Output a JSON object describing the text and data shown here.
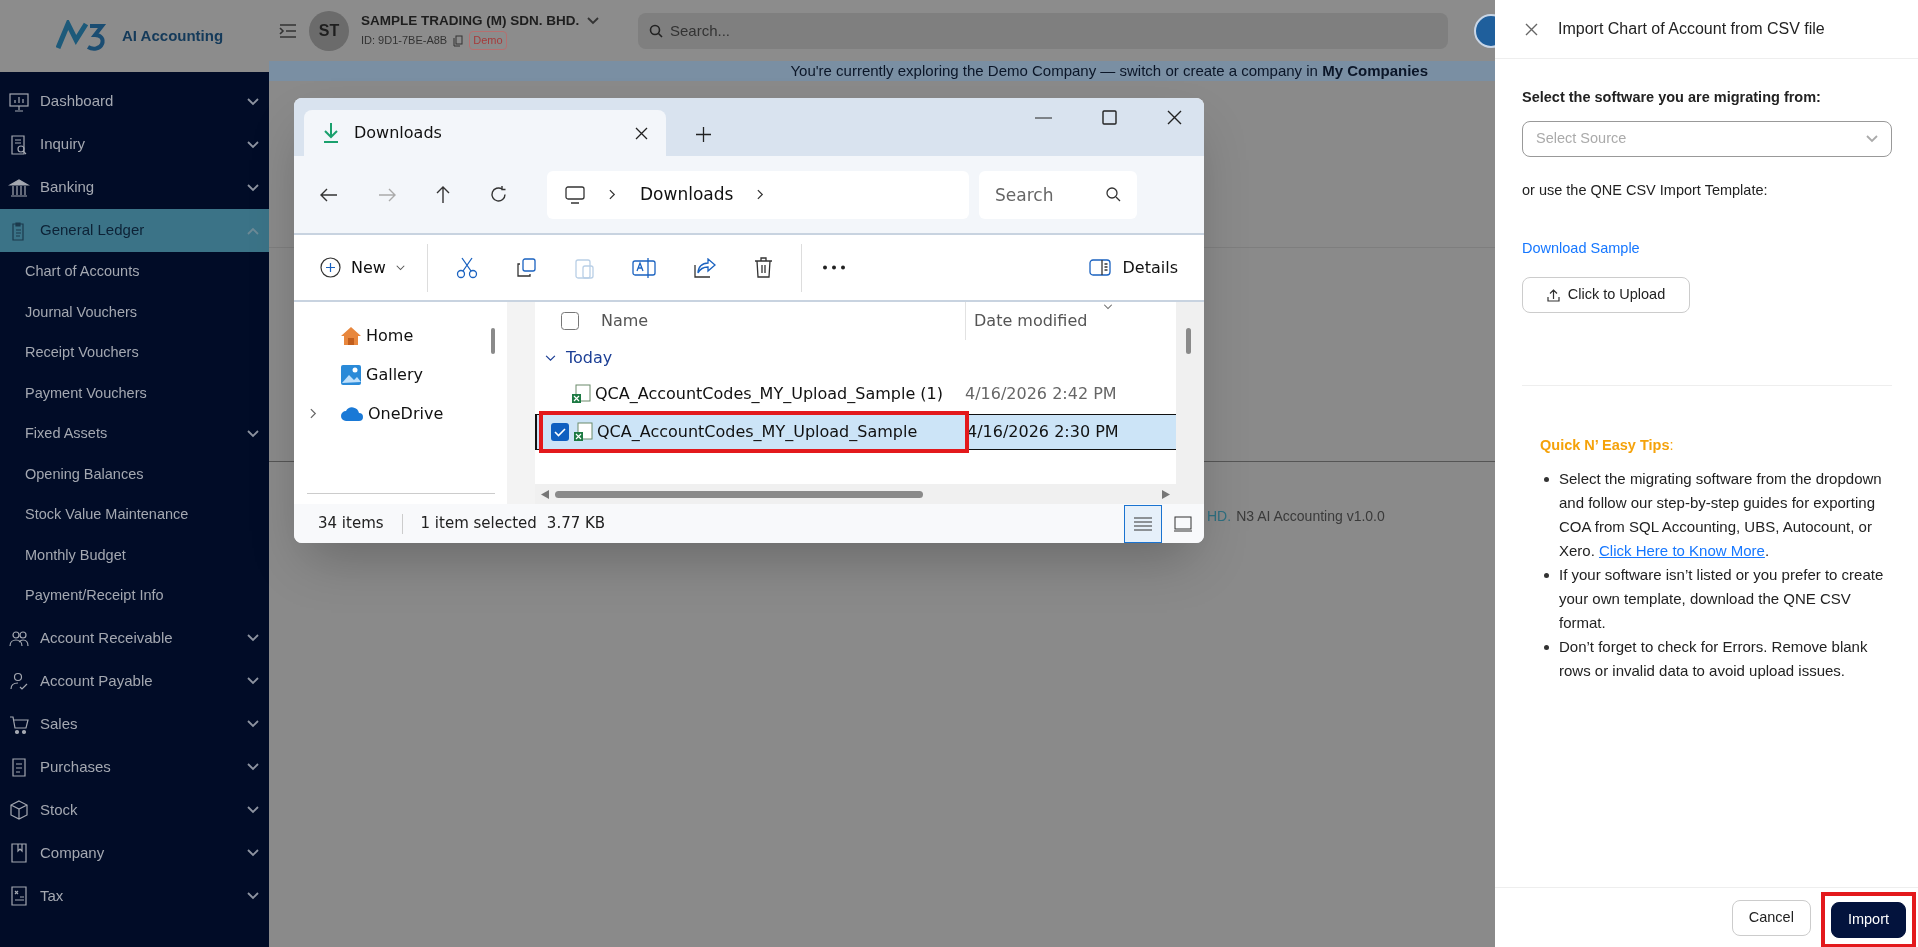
{
  "app": {
    "logo_text": "AI Accounting",
    "company": {
      "avatar": "ST",
      "name": "SAMPLE TRADING (M) SDN. BHD.",
      "id": "ID: 9D1-7BE-A8B",
      "badge": "Demo"
    },
    "search": {
      "placeholder": "Search..."
    },
    "banner": "You're currently exploring the Demo Company — switch or create a company in **My Companies**"
  },
  "sidebar": {
    "items": [
      {
        "label": "Dashboard",
        "expanded": false,
        "selected": false
      },
      {
        "label": "Inquiry",
        "expanded": false,
        "selected": false
      },
      {
        "label": "Banking",
        "expanded": false,
        "selected": false
      },
      {
        "label": "General Ledger",
        "expanded": true,
        "selected": true,
        "children": [
          {
            "label": "Chart of Accounts",
            "kind": "link"
          },
          {
            "label": "Journal Vouchers",
            "kind": "link"
          },
          {
            "label": "Receipt Vouchers",
            "kind": "link"
          },
          {
            "label": "Payment Vouchers",
            "kind": "link"
          },
          {
            "label": "Fixed Assets",
            "kind": "group"
          },
          {
            "label": "Opening Balances",
            "kind": "link"
          },
          {
            "label": "Stock Value Maintenance",
            "kind": "link"
          },
          {
            "label": "Monthly Budget",
            "kind": "link"
          },
          {
            "label": "Payment/Receipt Info",
            "kind": "link"
          }
        ]
      },
      {
        "label": "Account Receivable",
        "expanded": false,
        "selected": false
      },
      {
        "label": "Account Payable",
        "expanded": false,
        "selected": false
      },
      {
        "label": "Sales",
        "expanded": false,
        "selected": false
      },
      {
        "label": "Purchases",
        "expanded": false,
        "selected": false
      },
      {
        "label": "Stock",
        "expanded": false,
        "selected": false
      },
      {
        "label": "Company",
        "expanded": false,
        "selected": false
      },
      {
        "label": "Tax",
        "expanded": false,
        "selected": false
      }
    ]
  },
  "footer": {
    "company": "HD.",
    "version": "N3 AI Accounting v1.0.0"
  },
  "explorer": {
    "tab": "Downloads",
    "breadcrumb": "Downloads",
    "search": {
      "placeholder": "Search"
    },
    "toolbar": {
      "new": "New",
      "details": "Details"
    },
    "nav": [
      {
        "label": "Home",
        "expandable": false
      },
      {
        "label": "Gallery",
        "expandable": false
      },
      {
        "label": "OneDrive",
        "expandable": true
      }
    ],
    "columns": [
      "Name",
      "Date modified"
    ],
    "select_all": {
      "checked": false
    },
    "group": {
      "label": "Today",
      "expanded": true
    },
    "files": [
      {
        "name": "QCA_AccountCodes_MY_Upload_Sample (1)",
        "date": "4/16/2026 2:42 PM",
        "selected": false,
        "highlighted": false
      },
      {
        "name": "QCA_AccountCodes_MY_Upload_Sample",
        "date": "4/16/2026 2:30 PM",
        "selected": true,
        "highlighted": true
      }
    ],
    "status": {
      "count": "34 items",
      "selection": "1 item selected",
      "size": "3.77 KB"
    }
  },
  "panel": {
    "title": "Import Chart of Account from CSV file",
    "prompt": "Select the software you are migrating from:",
    "select": {
      "placeholder": "Select Source"
    },
    "alt_text": "or use the QNE CSV Import Template:",
    "download_link": "Download Sample",
    "upload_button": "Click to Upload",
    "tips_heading": "**Quick N’ Easy Tips**:",
    "tips": [
      {
        "text": "Select the migrating software from the dropdown and follow our step-by-step guides for exporting COA from SQL Accounting, UBS, Autocount, or Xero.",
        "link": "Click Here to Know More",
        "after": "."
      },
      {
        "text": "If your software isn’t listed or you prefer to create your own template, download the QNE CSV format."
      },
      {
        "text": "Don’t forget to check for Errors. Remove blank rows or invalid data to avoid upload issues."
      }
    ],
    "buttons": [
      {
        "label": "Cancel",
        "kind": "secondary",
        "highlighted": false
      },
      {
        "label": "Import",
        "kind": "primary",
        "highlighted": true
      }
    ]
  }
}
